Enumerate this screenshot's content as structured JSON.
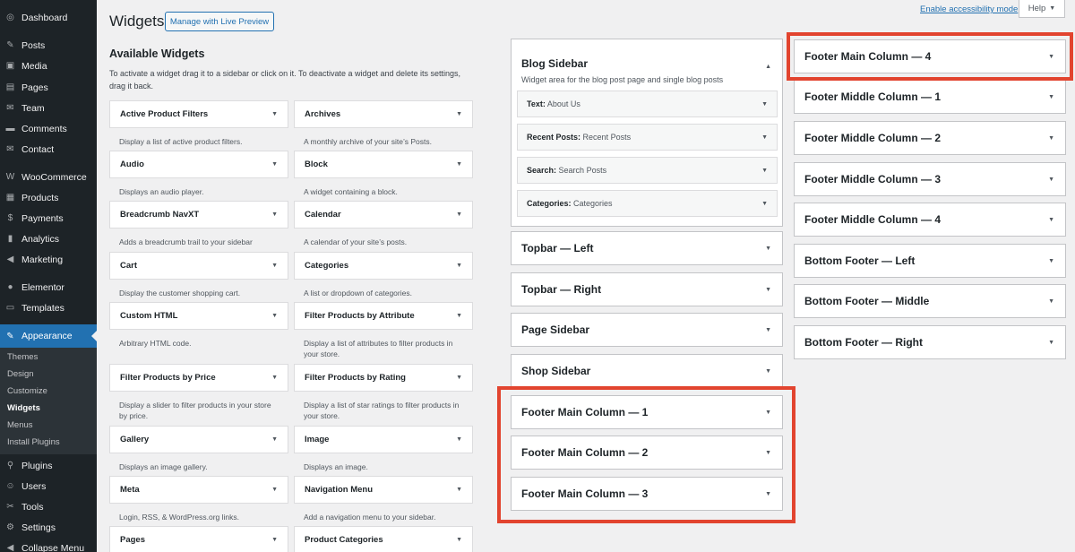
{
  "menu": {
    "items": [
      {
        "label": "Dashboard",
        "icon": "dashboard-icon",
        "glyph": "◎"
      },
      {
        "label": "Posts",
        "icon": "pin-icon",
        "glyph": "✎"
      },
      {
        "label": "Media",
        "icon": "media-icon",
        "glyph": "▣"
      },
      {
        "label": "Pages",
        "icon": "pages-icon",
        "glyph": "▤"
      },
      {
        "label": "Team",
        "icon": "team-icon",
        "glyph": "✉"
      },
      {
        "label": "Comments",
        "icon": "comments-icon",
        "glyph": "▬"
      },
      {
        "label": "Contact",
        "icon": "contact-icon",
        "glyph": "✉"
      },
      {
        "label": "WooCommerce",
        "icon": "woo-icon",
        "glyph": "W"
      },
      {
        "label": "Products",
        "icon": "products-icon",
        "glyph": "▦"
      },
      {
        "label": "Payments",
        "icon": "payments-icon",
        "glyph": "$"
      },
      {
        "label": "Analytics",
        "icon": "analytics-icon",
        "glyph": "▮"
      },
      {
        "label": "Marketing",
        "icon": "marketing-icon",
        "glyph": "◀"
      },
      {
        "label": "Elementor",
        "icon": "elementor-icon",
        "glyph": "●"
      },
      {
        "label": "Templates",
        "icon": "templates-icon",
        "glyph": "▭"
      },
      {
        "label": "Appearance",
        "icon": "brush-icon",
        "glyph": "✎"
      },
      {
        "label": "Plugins",
        "icon": "plugins-icon",
        "glyph": "⚲"
      },
      {
        "label": "Users",
        "icon": "users-icon",
        "glyph": "☺"
      },
      {
        "label": "Tools",
        "icon": "tools-icon",
        "glyph": "✂"
      },
      {
        "label": "Settings",
        "icon": "settings-icon",
        "glyph": "⚙"
      },
      {
        "label": "Collapse Menu",
        "icon": "collapse-icon",
        "glyph": "◀"
      }
    ],
    "submenu": [
      "Themes",
      "Design",
      "Customize",
      "Widgets",
      "Menus",
      "Install Plugins"
    ]
  },
  "header": {
    "title": "Widgets",
    "live_preview": "Manage with Live Preview",
    "accessibility": "Enable accessibility mode",
    "help": "Help",
    "help_caret": "▼"
  },
  "available": {
    "title": "Available Widgets",
    "desc": "To activate a widget drag it to a sidebar or click on it. To deactivate a widget and delete its settings, drag it back.",
    "caret": "▼",
    "widgets": [
      {
        "name": "Active Product Filters",
        "desc": "Display a list of active product filters."
      },
      {
        "name": "Archives",
        "desc": "A monthly archive of your site’s Posts."
      },
      {
        "name": "Audio",
        "desc": "Displays an audio player."
      },
      {
        "name": "Block",
        "desc": "A widget containing a block."
      },
      {
        "name": "Breadcrumb NavXT",
        "desc": "Adds a breadcrumb trail to your sidebar"
      },
      {
        "name": "Calendar",
        "desc": "A calendar of your site’s posts."
      },
      {
        "name": "Cart",
        "desc": "Display the customer shopping cart."
      },
      {
        "name": "Categories",
        "desc": "A list or dropdown of categories."
      },
      {
        "name": "Custom HTML",
        "desc": "Arbitrary HTML code."
      },
      {
        "name": "Filter Products by Attribute",
        "desc": "Display a list of attributes to filter products in your store."
      },
      {
        "name": "Filter Products by Price",
        "desc": "Display a slider to filter products in your store by price."
      },
      {
        "name": "Filter Products by Rating",
        "desc": "Display a list of star ratings to filter products in your store."
      },
      {
        "name": "Gallery",
        "desc": "Displays an image gallery."
      },
      {
        "name": "Image",
        "desc": "Displays an image."
      },
      {
        "name": "Meta",
        "desc": "Login, RSS, & WordPress.org links."
      },
      {
        "name": "Navigation Menu",
        "desc": "Add a navigation menu to your sidebar."
      },
      {
        "name": "Pages",
        "desc": ""
      },
      {
        "name": "Product Categories",
        "desc": ""
      }
    ]
  },
  "blog_sidebar": {
    "title": "Blog Sidebar",
    "desc": "Widget area for the blog post page and single blog posts",
    "open_caret": "▲",
    "widgets": [
      {
        "type": "Text:",
        "title": "About Us"
      },
      {
        "type": "Recent Posts:",
        "title": "Recent Posts"
      },
      {
        "type": "Search:",
        "title": "Search Posts"
      },
      {
        "type": "Categories:",
        "title": "Categories"
      }
    ]
  },
  "sidebars_mid": [
    "Topbar — Left",
    "Topbar — Right",
    "Page Sidebar",
    "Shop Sidebar",
    "Footer Main Column — 1",
    "Footer Main Column — 2",
    "Footer Main Column — 3"
  ],
  "sidebars_right": [
    "Footer Main Column — 4",
    "Footer Middle Column — 1",
    "Footer Middle Column — 2",
    "Footer Middle Column — 3",
    "Footer Middle Column — 4",
    "Bottom Footer — Left",
    "Bottom Footer — Middle",
    "Bottom Footer — Right"
  ],
  "colors": {
    "highlight": "#e2442f",
    "accent": "#2271b1",
    "sidebar": "#1d2327"
  }
}
